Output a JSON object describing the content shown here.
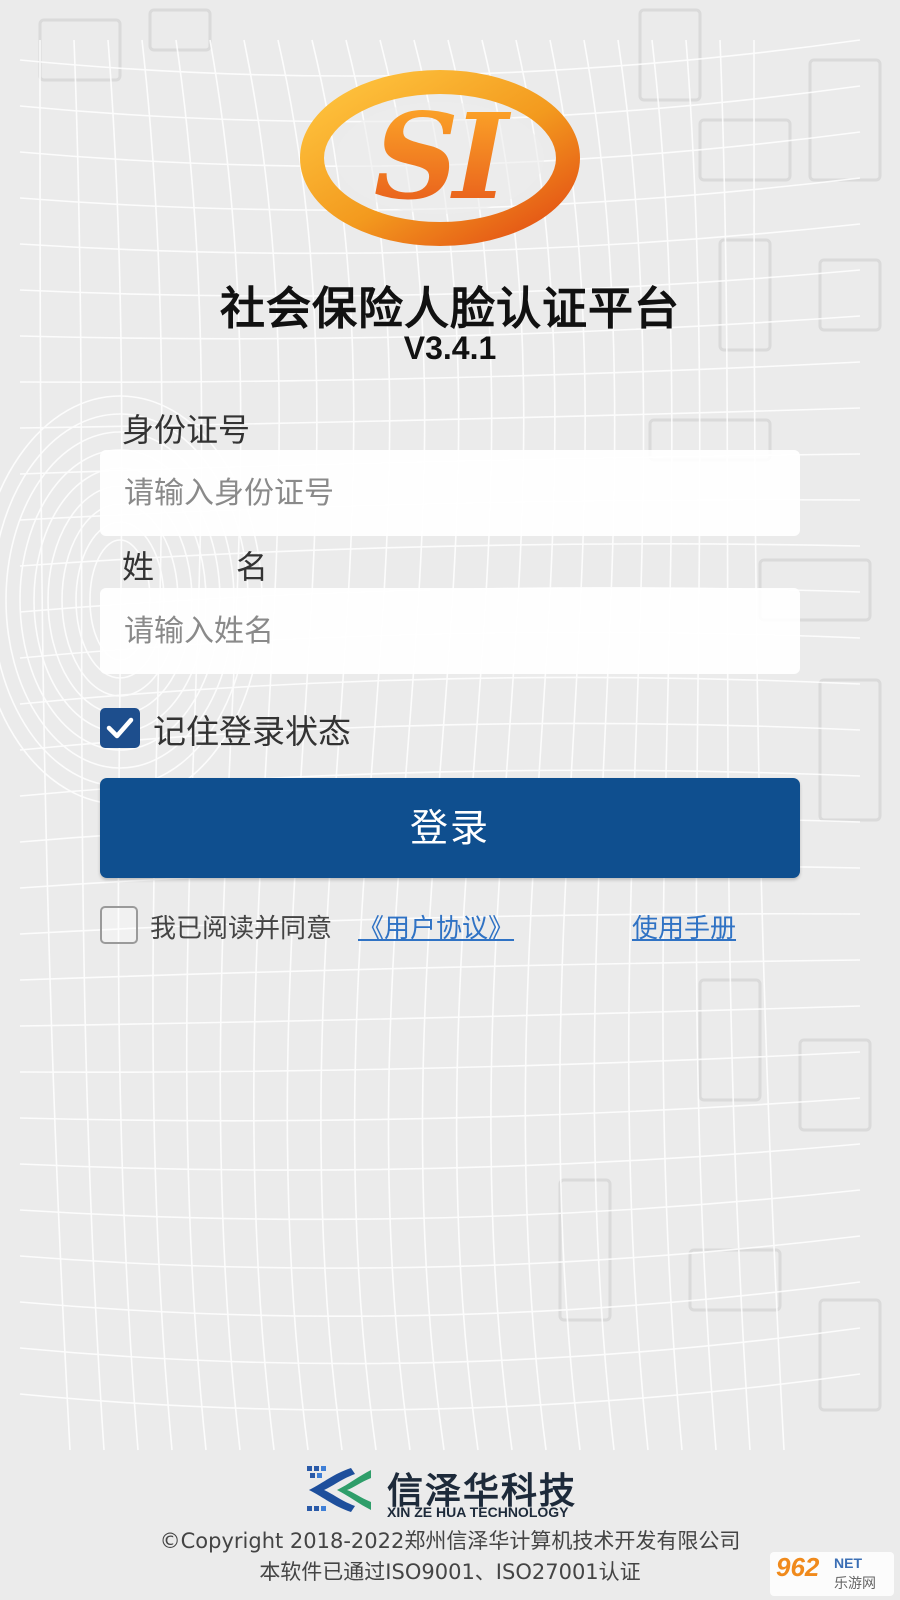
{
  "header": {
    "logo_icon": "si-social-insurance-logo",
    "title": "社会保险人脸认证平台",
    "version": "V3.4.1"
  },
  "form": {
    "id_label": "身份证号",
    "id_placeholder": "请输入身份证号",
    "id_value": "",
    "name_label_first": "姓",
    "name_label_second": "名",
    "name_placeholder": "请输入姓名",
    "name_value": "",
    "remember_checked": true,
    "remember_label": "记住登录状态",
    "login_button": "登录",
    "agree_checked": false,
    "agree_text": "我已阅读并同意",
    "agreement_link": "《用户协议》",
    "manual_link": "使用手册"
  },
  "footer": {
    "company_icon": "xinzehua-logo",
    "company_name": "信泽华科技",
    "company_en": "XIN ZE HUA TECHNOLOGY",
    "copyright": "©Copyright 2018-2022郑州信泽华计算机技术开发有限公司",
    "certification": "本软件已通过ISO9001、ISO27001认证"
  },
  "watermark": {
    "number": "962",
    "suffix": "NET",
    "cn": "乐游网"
  },
  "colors": {
    "primary": "#0f4f8f",
    "checkbox": "#1d4e8d",
    "link": "#2f72c4",
    "logo_orange": "#f39a1e",
    "logo_red": "#e24a14"
  }
}
